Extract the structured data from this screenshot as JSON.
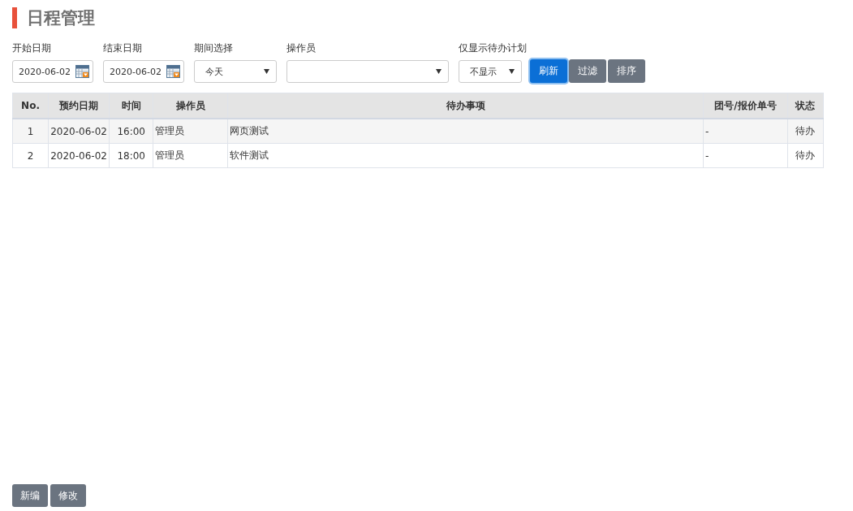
{
  "title": "日程管理",
  "filters": [
    {
      "label": "开始日期",
      "kind": "date",
      "value": "2020-06-02"
    },
    {
      "label": "结束日期",
      "kind": "date",
      "value": "2020-06-02"
    },
    {
      "label": "期间选择",
      "kind": "select",
      "value": "今天"
    },
    {
      "label": "操作员",
      "kind": "select"
    },
    {
      "label": "仅显示待办计划",
      "kind": "select",
      "value": "不显示"
    }
  ],
  "buttons": [
    {
      "label": "刷新",
      "kind": "primary"
    },
    {
      "label": "过滤",
      "kind": "secondary"
    },
    {
      "label": "排序",
      "kind": "secondary"
    }
  ],
  "table": {
    "columns": [
      "No.",
      "预约日期",
      "时间",
      "操作员",
      "待办事项",
      "团号/报价单号",
      "状态"
    ],
    "rows": [
      [
        "1",
        "2020-06-02",
        "16:00",
        "管理员",
        "网页测试",
        "-",
        "待办"
      ],
      [
        "2",
        "2020-06-02",
        "18:00",
        "管理员",
        "软件测试",
        "-",
        "待办"
      ]
    ]
  },
  "footer_buttons": [
    "新编",
    "修改"
  ]
}
